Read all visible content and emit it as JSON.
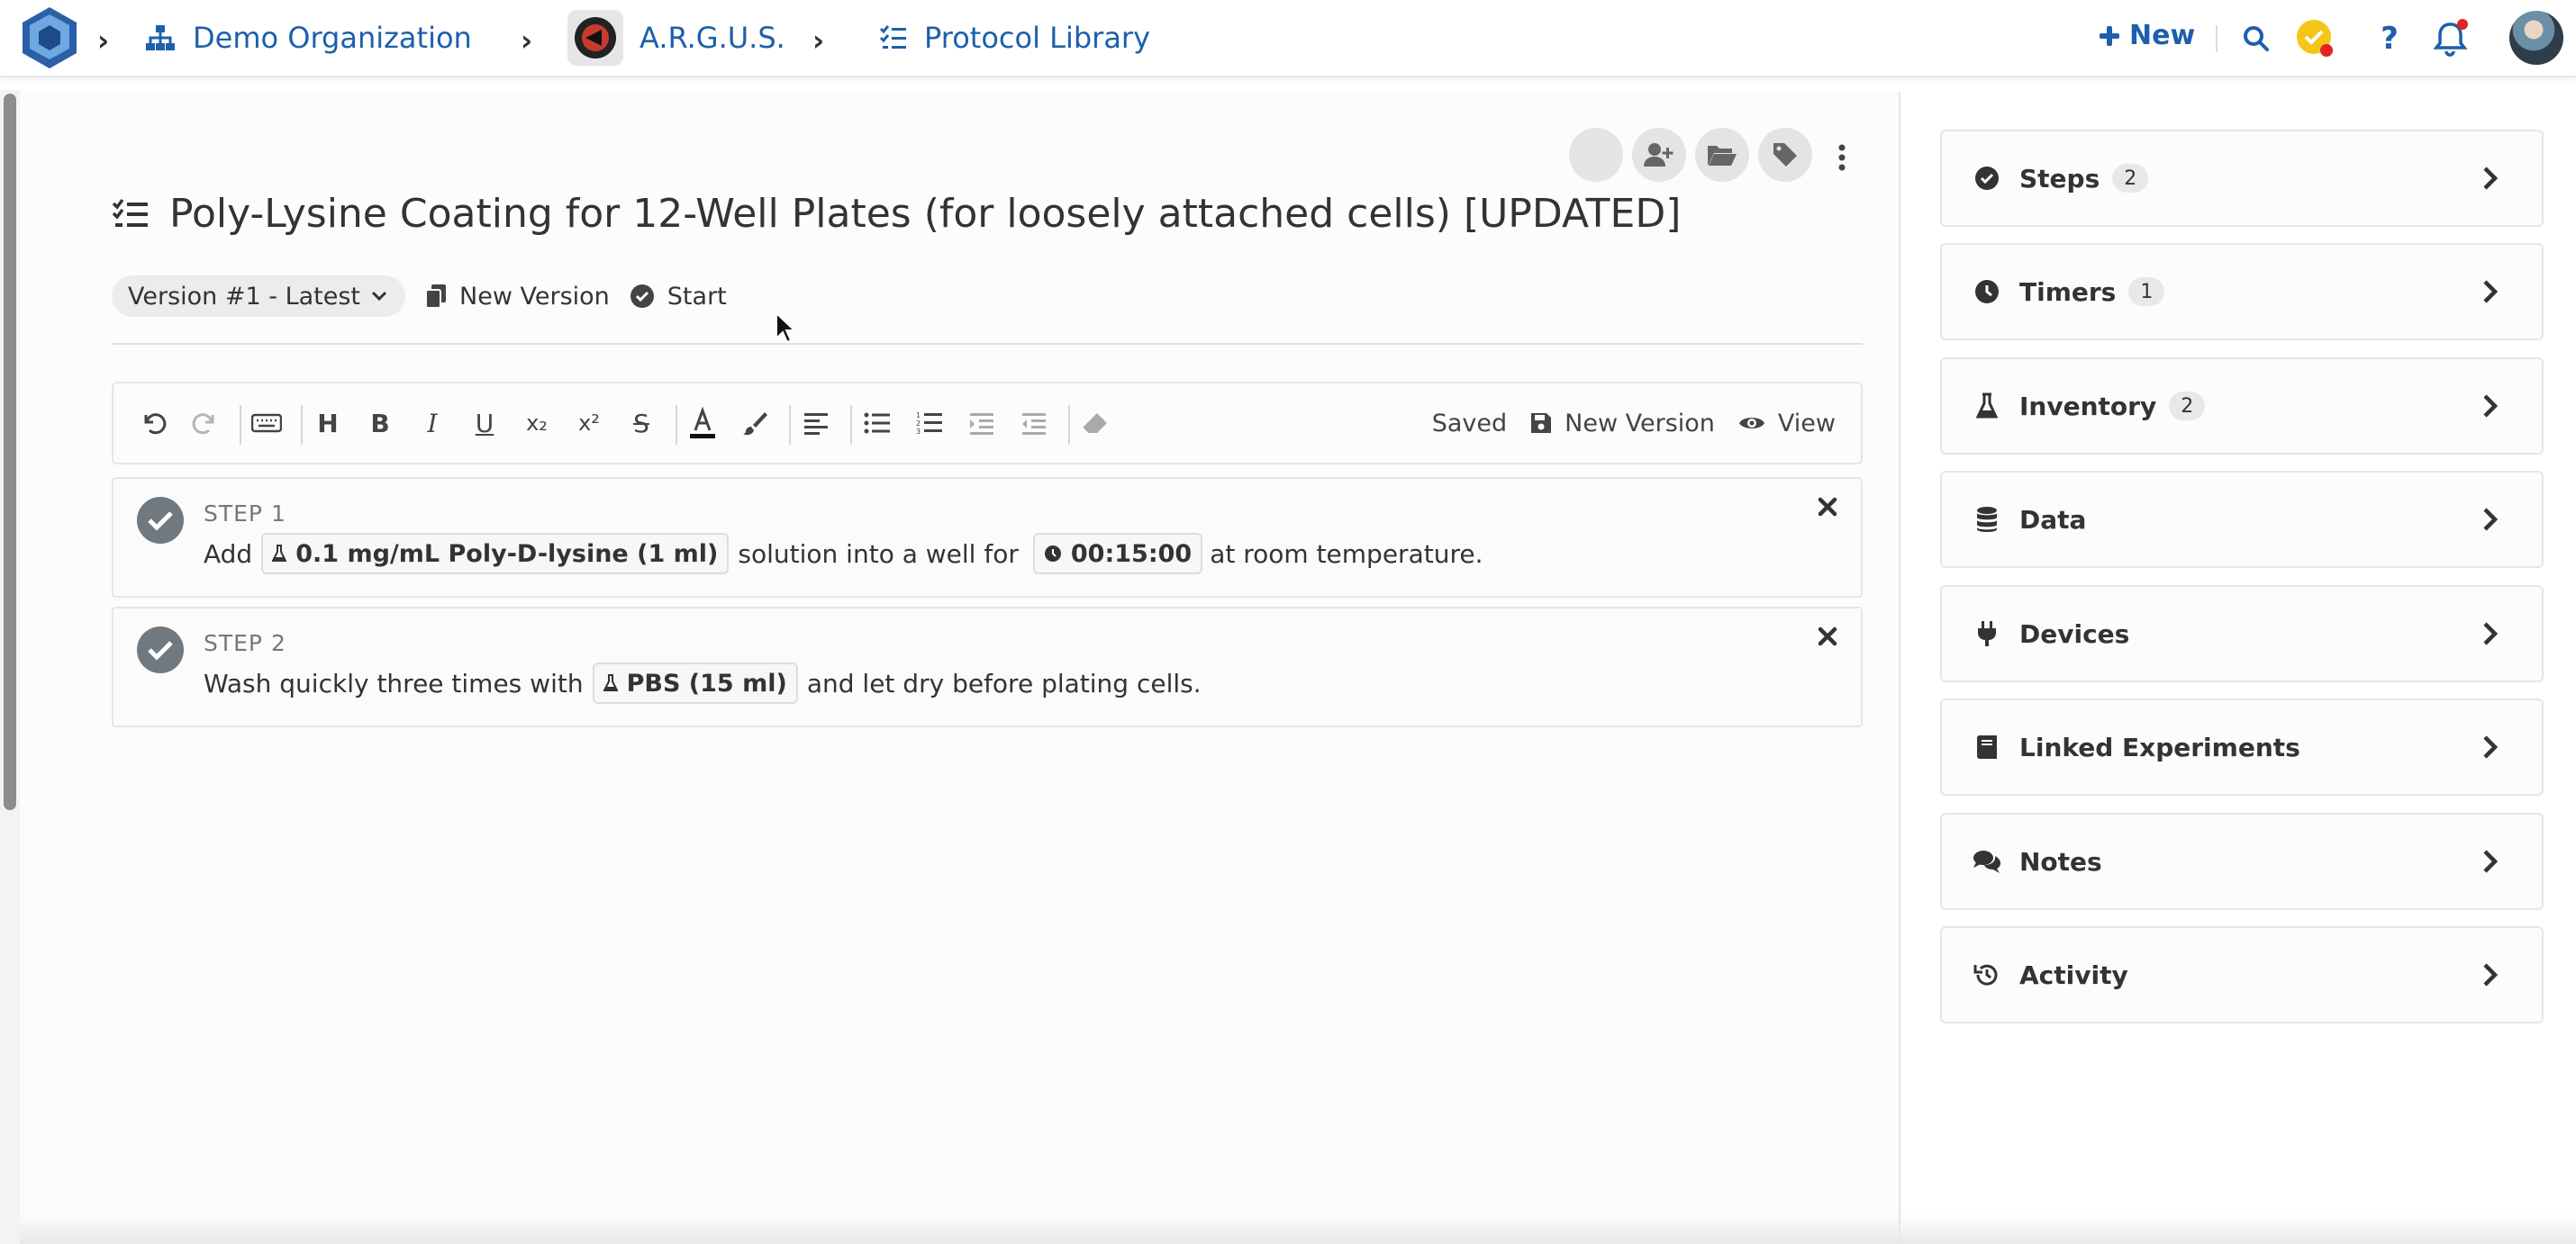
{
  "breadcrumb": {
    "organization": "Demo Organization",
    "project": "A.R.G.U.S.",
    "section": "Protocol Library"
  },
  "nav": {
    "new_label": "New"
  },
  "protocol": {
    "title": "Poly-Lysine Coating for 12-Well Plates (for loosely attached cells) [UPDATED]",
    "version_label": "Version #1 - Latest",
    "new_version_label": "New Version",
    "start_label": "Start"
  },
  "toolbar": {
    "status": "Saved",
    "new_version_label": "New Version",
    "view_label": "View"
  },
  "steps": [
    {
      "label": "STEP 1",
      "text_before": "Add",
      "reagent": "0.1 mg/mL Poly-D-lysine (1 ml)",
      "text_middle": "solution into a well for",
      "timer": "00:15:00",
      "text_after": "at room temperature."
    },
    {
      "label": "STEP 2",
      "text_before": "Wash quickly three times with",
      "reagent": "PBS (15 ml)",
      "text_after": "and let dry before plating cells."
    }
  ],
  "sidebar": {
    "items": [
      {
        "label": "Steps",
        "count": "2",
        "icon": "check-circle-icon"
      },
      {
        "label": "Timers",
        "count": "1",
        "icon": "clock-icon"
      },
      {
        "label": "Inventory",
        "count": "2",
        "icon": "flask-icon"
      },
      {
        "label": "Data",
        "count": "",
        "icon": "database-icon"
      },
      {
        "label": "Devices",
        "count": "",
        "icon": "plug-icon"
      },
      {
        "label": "Linked Experiments",
        "count": "",
        "icon": "book-icon"
      },
      {
        "label": "Notes",
        "count": "",
        "icon": "comments-icon"
      },
      {
        "label": "Activity",
        "count": "",
        "icon": "history-icon"
      }
    ]
  },
  "colors": {
    "link_blue": "#1d5fad",
    "task_yellow": "#f5c518",
    "notification_red": "#e02424"
  }
}
